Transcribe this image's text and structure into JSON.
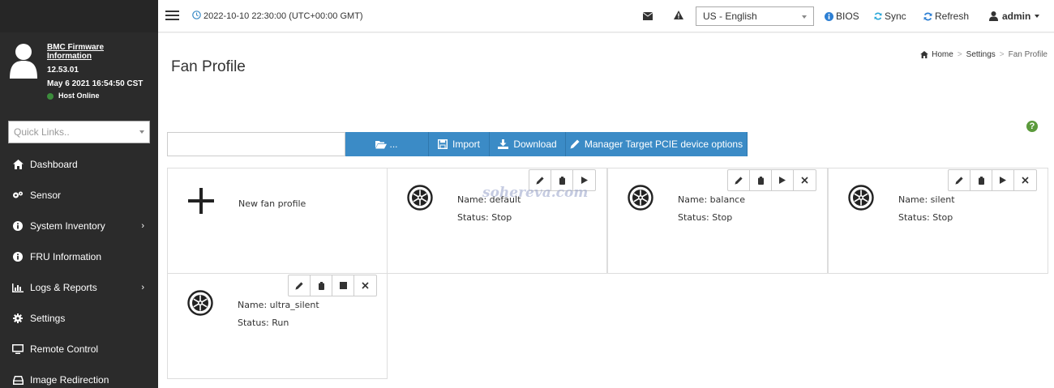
{
  "colors": {
    "sidebar": "#2b2b2b",
    "accent": "#3b8bc6",
    "status_online": "#3c8c3c",
    "help": "#5b9a3c"
  },
  "header": {
    "datetime": "2022-10-10 22:30:00 (UTC+00:00 GMT)",
    "language": "US - English",
    "bios_label": "BIOS",
    "sync_label": "Sync",
    "refresh_label": "Refresh",
    "user_label": "admin"
  },
  "sidebar": {
    "fw_title": "BMC Firmware Information",
    "fw_version": "12.53.01",
    "fw_date": "May 6 2021 16:54:50 CST",
    "host_status": "Host Online",
    "quicklinks_placeholder": "Quick Links..",
    "items": [
      {
        "label": "Dashboard",
        "icon": "dashboard-icon"
      },
      {
        "label": "Sensor",
        "icon": "sensor-icon"
      },
      {
        "label": "System Inventory",
        "icon": "info-icon"
      },
      {
        "label": "FRU Information",
        "icon": "info-icon"
      },
      {
        "label": "Logs & Reports",
        "icon": "bar-chart-icon"
      },
      {
        "label": "Settings",
        "icon": "gear-icon"
      },
      {
        "label": "Remote Control",
        "icon": "monitor-icon"
      },
      {
        "label": "Image Redirection",
        "icon": "disk-icon"
      }
    ]
  },
  "breadcrumb": {
    "home": "Home",
    "settings": "Settings",
    "current": "Fan Profile"
  },
  "page": {
    "title": "Fan Profile",
    "browse_label": "...",
    "import_label": "Import",
    "download_label": "Download",
    "manager_label": "Manager Target PCIE device options"
  },
  "new_profile_label": "New fan profile",
  "profiles": [
    {
      "name_label": "Name:",
      "name": "default",
      "status_label": "Status:",
      "status": "Stop"
    },
    {
      "name_label": "Name:",
      "name": "balance",
      "status_label": "Status:",
      "status": "Stop"
    },
    {
      "name_label": "Name:",
      "name": "silent",
      "status_label": "Status:",
      "status": "Stop"
    },
    {
      "name_label": "Name:",
      "name": "ultra_silent",
      "status_label": "Status:",
      "status": "Run"
    }
  ],
  "watermark": "sohereva.com"
}
